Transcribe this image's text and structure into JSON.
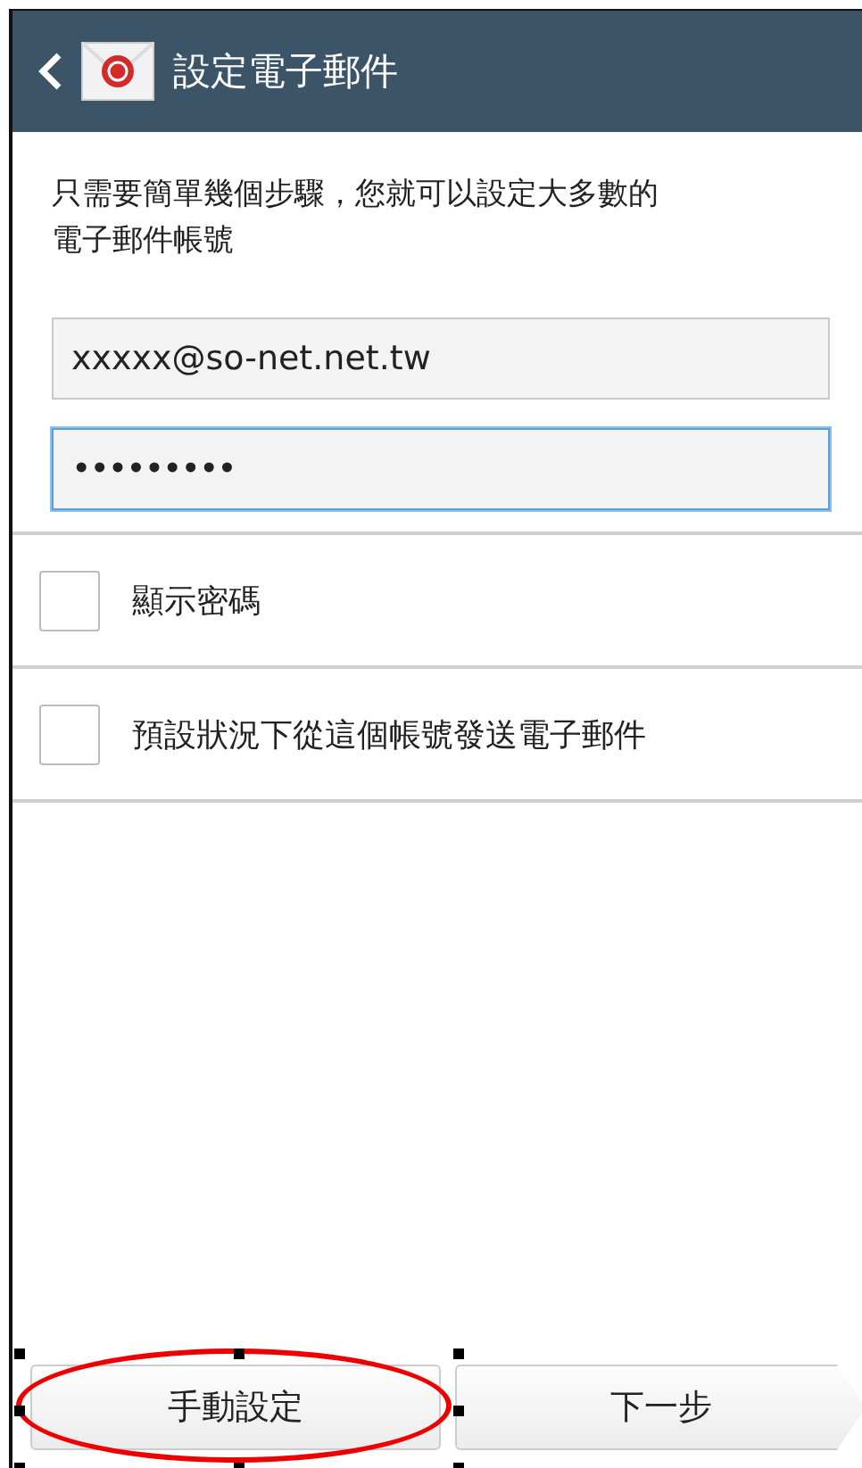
{
  "header": {
    "title": "設定電子郵件"
  },
  "intro": "只需要簡單幾個步驟，您就可以設定大多數的電子郵件帳號",
  "fields": [
    {
      "kind": "email",
      "value": "xxxxx@so-net.net.tw",
      "focused": false
    },
    {
      "kind": "password",
      "value": "•••••••••",
      "focused": true
    }
  ],
  "options": [
    {
      "label": "顯示密碼",
      "checked": false
    },
    {
      "label": "預設狀況下從這個帳號發送電子郵件",
      "checked": false
    }
  ],
  "buttons": [
    {
      "label": "手動設定",
      "kind": "plain",
      "highlighted": true
    },
    {
      "label": "下一步",
      "kind": "next",
      "highlighted": false
    }
  ]
}
